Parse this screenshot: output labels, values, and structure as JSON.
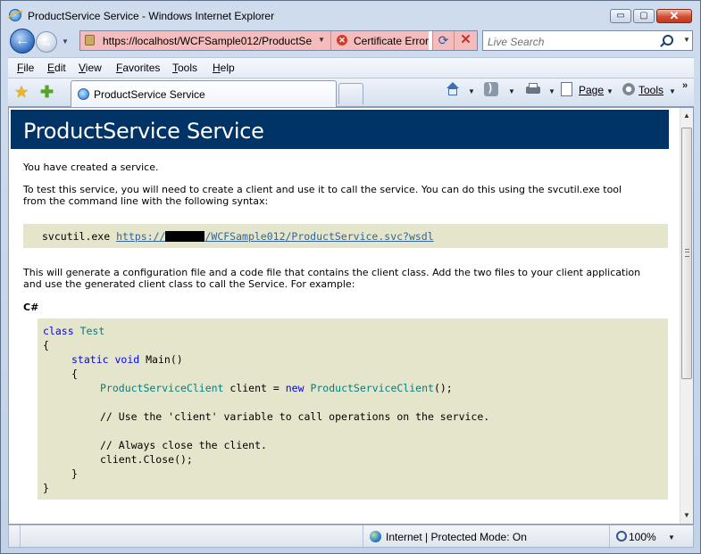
{
  "window": {
    "title": "ProductService Service - Windows Internet Explorer",
    "buttons": {
      "minimize": "▭",
      "maximize": "▢",
      "close": "✕"
    }
  },
  "nav": {
    "url": "https://localhost/WCFSample012/ProductSe",
    "cert_error": "Certificate Error",
    "search_placeholder": "Live Search"
  },
  "menu": [
    {
      "label": "File",
      "u": "F",
      "rest": "ile"
    },
    {
      "label": "Edit",
      "u": "E",
      "rest": "dit"
    },
    {
      "label": "View",
      "u": "V",
      "rest": "iew"
    },
    {
      "label": "Favorites",
      "u": "F",
      "rest": "avorites"
    },
    {
      "label": "Tools",
      "u": "T",
      "rest": "ools"
    },
    {
      "label": "Help",
      "u": "H",
      "rest": "elp"
    }
  ],
  "tab": {
    "title": "ProductService Service"
  },
  "commandbar": {
    "page": "Page",
    "tools": "Tools"
  },
  "content": {
    "heading": "ProductService Service",
    "p1": "You have created a service.",
    "p2a": "To test this service, you will need to create a client and use it to call the service. You can do this using the svcutil.exe tool",
    "p2b": "from the command line with the following syntax:",
    "svcutil_cmd": "svcutil.exe ",
    "svcutil_link_a": "https://",
    "svcutil_link_b": "/WCFSample012/ProductService.svc?wsdl",
    "p3a": "This will generate a configuration file and a code file that contains the client class. Add the two files to your client application",
    "p3b": "and use the generated client class to call the Service. For example:",
    "lang": "C#",
    "code": {
      "l1_kw": "class",
      "l1_ty": "Test",
      "l2": "{",
      "l3_kw1": "static",
      "l3_kw2": "void",
      "l3_rest": "Main()",
      "l4": "{",
      "l5_ty1": "ProductServiceClient",
      "l5_mid": " client = ",
      "l5_kw": "new",
      "l5_ty2": "ProductServiceClient",
      "l5_end": "();",
      "l6": "// Use the 'client' variable to call operations on the service.",
      "l7": "// Always close the client.",
      "l8": "client.Close();",
      "l9": "}",
      "l10": "}"
    }
  },
  "status": {
    "zone": "Internet | Protected Mode: On",
    "zoom": "100%"
  }
}
